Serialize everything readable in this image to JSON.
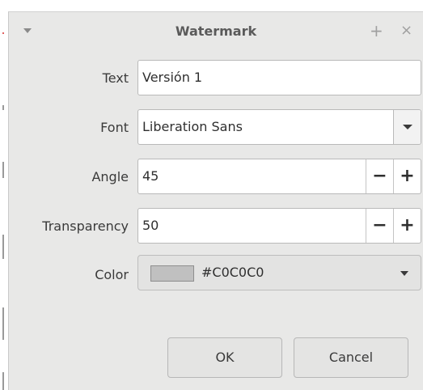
{
  "dialog": {
    "title": "Watermark",
    "titlebar_icons": [
      "menu-arrow-icon",
      "maximize-plus-icon",
      "close-icon"
    ],
    "plus_glyph": "+",
    "close_glyph": "×"
  },
  "form": {
    "text": {
      "label": "Text",
      "value": "Versión 1"
    },
    "font": {
      "label": "Font",
      "value": "Liberation Sans"
    },
    "angle": {
      "label": "Angle",
      "value": "45",
      "decrement": "−",
      "increment": "+"
    },
    "transparency": {
      "label": "Transparency",
      "value": "50",
      "decrement": "−",
      "increment": "+"
    },
    "color": {
      "label": "Color",
      "value": "#C0C0C0",
      "swatch": "#c0c0c0"
    }
  },
  "buttons": {
    "ok": "OK",
    "cancel": "Cancel"
  }
}
